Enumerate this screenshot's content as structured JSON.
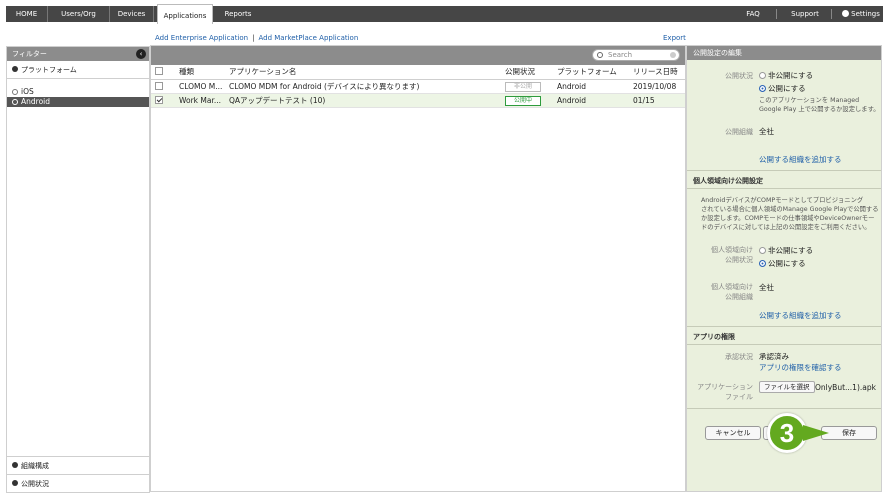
{
  "nav": {
    "home": "HOME",
    "users_org": "Users/Org",
    "devices": "Devices",
    "applications": "Applications",
    "reports": "Reports",
    "faq": "FAQ",
    "support": "Support",
    "settings": "Settings"
  },
  "sidebar": {
    "header": "フィルター",
    "platform_section": "プラットフォーム",
    "options": [
      "iOS",
      "Android"
    ],
    "selected_option": "Android",
    "org_section": "組織構成",
    "status_section": "公開状況"
  },
  "links": {
    "add_enterprise": "Add Enterprise Application",
    "separator": "|",
    "add_marketplace": "Add MarketPlace Application",
    "export": "Export"
  },
  "search": {
    "placeholder": "Search"
  },
  "table": {
    "columns": [
      "種類",
      "アプリケーション名",
      "公開状況",
      "プラットフォーム",
      "リリース日時"
    ],
    "rows": [
      {
        "type": "CLOMO M...",
        "name": "CLOMO MDM for Android (デバイスにより異なります)",
        "status": "非公開",
        "platform": "Android",
        "date": "2019/10/08",
        "checked": false
      },
      {
        "type": "Work Mar...",
        "name": "QAアップデートテスト (10)",
        "status": "公開中",
        "platform": "Android",
        "date": "01/15",
        "checked": true
      }
    ]
  },
  "panel": {
    "header": "公開設定の編集",
    "status_label": "公開状況",
    "opt_private": "非公開にする",
    "opt_public": "公開にする",
    "public_note_1": "このアプリケーションを Managed",
    "public_note_2": "Google Play 上で公開するか設定します。",
    "org_label": "公開組織",
    "org_value": "全社",
    "add_org_link": "公開する組織を追加する",
    "personal_title": "個人領域向け公開設定",
    "personal_note_1": "AndroidデバイスがCOMPモードとしてプロビジョニング",
    "personal_note_2": "されている場合に個人領域のManage Google Playで公開する",
    "personal_note_3": "か設定します。COMPモードの仕事領域やDeviceOwnerモー",
    "personal_note_4": "ドのデバイスに対しては上記の公開設定をご利用ください。",
    "personal_status_label_1": "個人領域向け",
    "personal_status_label_2": "公開状況",
    "personal_org_label_1": "個人領域向け",
    "personal_org_label_2": "公開組織",
    "personal_org_value": "全社",
    "personal_add_org_link": "公開する組織を追加する",
    "perm_title": "アプリの権限",
    "approval_label": "承認状況",
    "approval_value": "承認済み",
    "approval_link": "アプリの権限を確認する",
    "app_file_label_1": "アプリケーション",
    "app_file_label_2": "ファイル",
    "file_button": "ファイルを選択",
    "file_name": "OnlyBut...1).apk",
    "cancel": "キャンセル",
    "save": "保存"
  },
  "step_marker": "3",
  "colors": {
    "nav_bg": "#464646",
    "header_gray": "#8c8c8c",
    "panel_bg": "#eaf0dd",
    "link_blue": "#1f5fa8",
    "step_green": "#63a91f",
    "status_green": "#2e9b3d"
  }
}
